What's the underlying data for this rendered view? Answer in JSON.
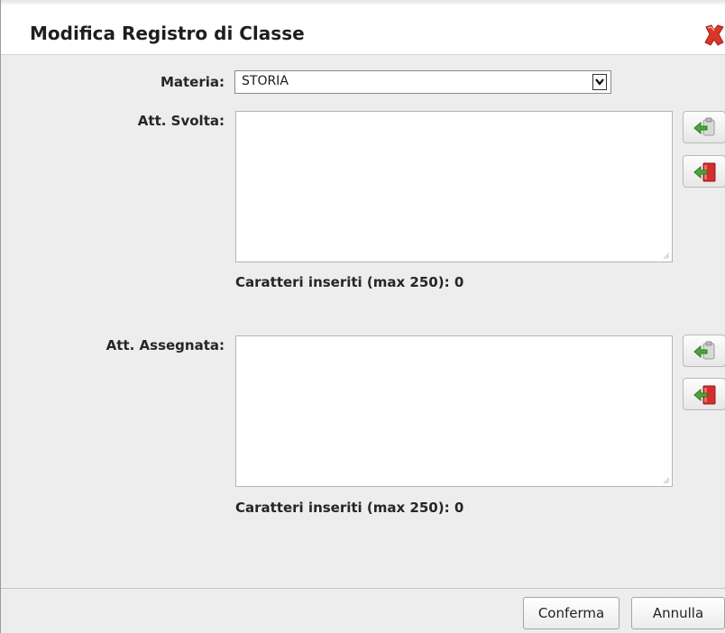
{
  "dialog": {
    "title": "Modifica Registro di Classe",
    "close_icon": "close-x-icon"
  },
  "form": {
    "materia": {
      "label": "Materia:",
      "selected": "STORIA"
    },
    "att_svolta": {
      "label": "Att. Svolta:",
      "value": "",
      "counter": "Caratteri inseriti (max 250): 0",
      "buttons": [
        {
          "icon": "insert-from-clipboard-icon"
        },
        {
          "icon": "insert-from-book-icon"
        }
      ]
    },
    "att_assegnata": {
      "label": "Att. Assegnata:",
      "value": "",
      "counter": "Caratteri inseriti (max 250): 0",
      "buttons": [
        {
          "icon": "insert-from-clipboard-icon"
        },
        {
          "icon": "insert-from-book-icon"
        }
      ]
    }
  },
  "footer": {
    "confirm_label": "Conferma",
    "cancel_label": "Annulla"
  },
  "colors": {
    "close_red": "#d9372b",
    "arrow_green": "#4aa83a",
    "book_red": "#d42d2d"
  }
}
